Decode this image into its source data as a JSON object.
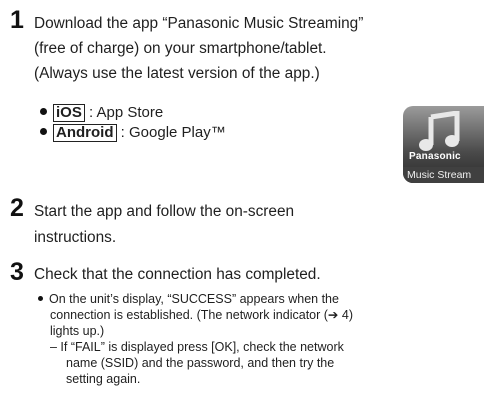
{
  "step1": {
    "number": "1",
    "lines": [
      "Download the app “Panasonic Music Streaming”",
      "(free of charge) on your smartphone/tablet.",
      "(Always use the latest version of the app.)"
    ],
    "platforms": [
      {
        "tag": "iOS",
        "sep": " : ",
        "store": "App Store"
      },
      {
        "tag": "Android",
        "sep": " : ",
        "store": "Google Play™"
      }
    ]
  },
  "app_icon": {
    "icon": "music-note-icon",
    "brand": "Panasonic",
    "name": "Music Stream"
  },
  "step2": {
    "number": "2",
    "lines": [
      "Start the app and follow the on-screen",
      "instructions."
    ]
  },
  "step3": {
    "number": "3",
    "lines": [
      "Check that the connection has completed."
    ],
    "notes": [
      "On the unit’s display, “SUCCESS” appears when the",
      "connection is established. (The network indicator (➔ 4)",
      "lights up.)",
      "–  If “FAIL” is displayed press [OK], check the network",
      "name (SSID) and the password, and then try the",
      "setting again."
    ]
  }
}
